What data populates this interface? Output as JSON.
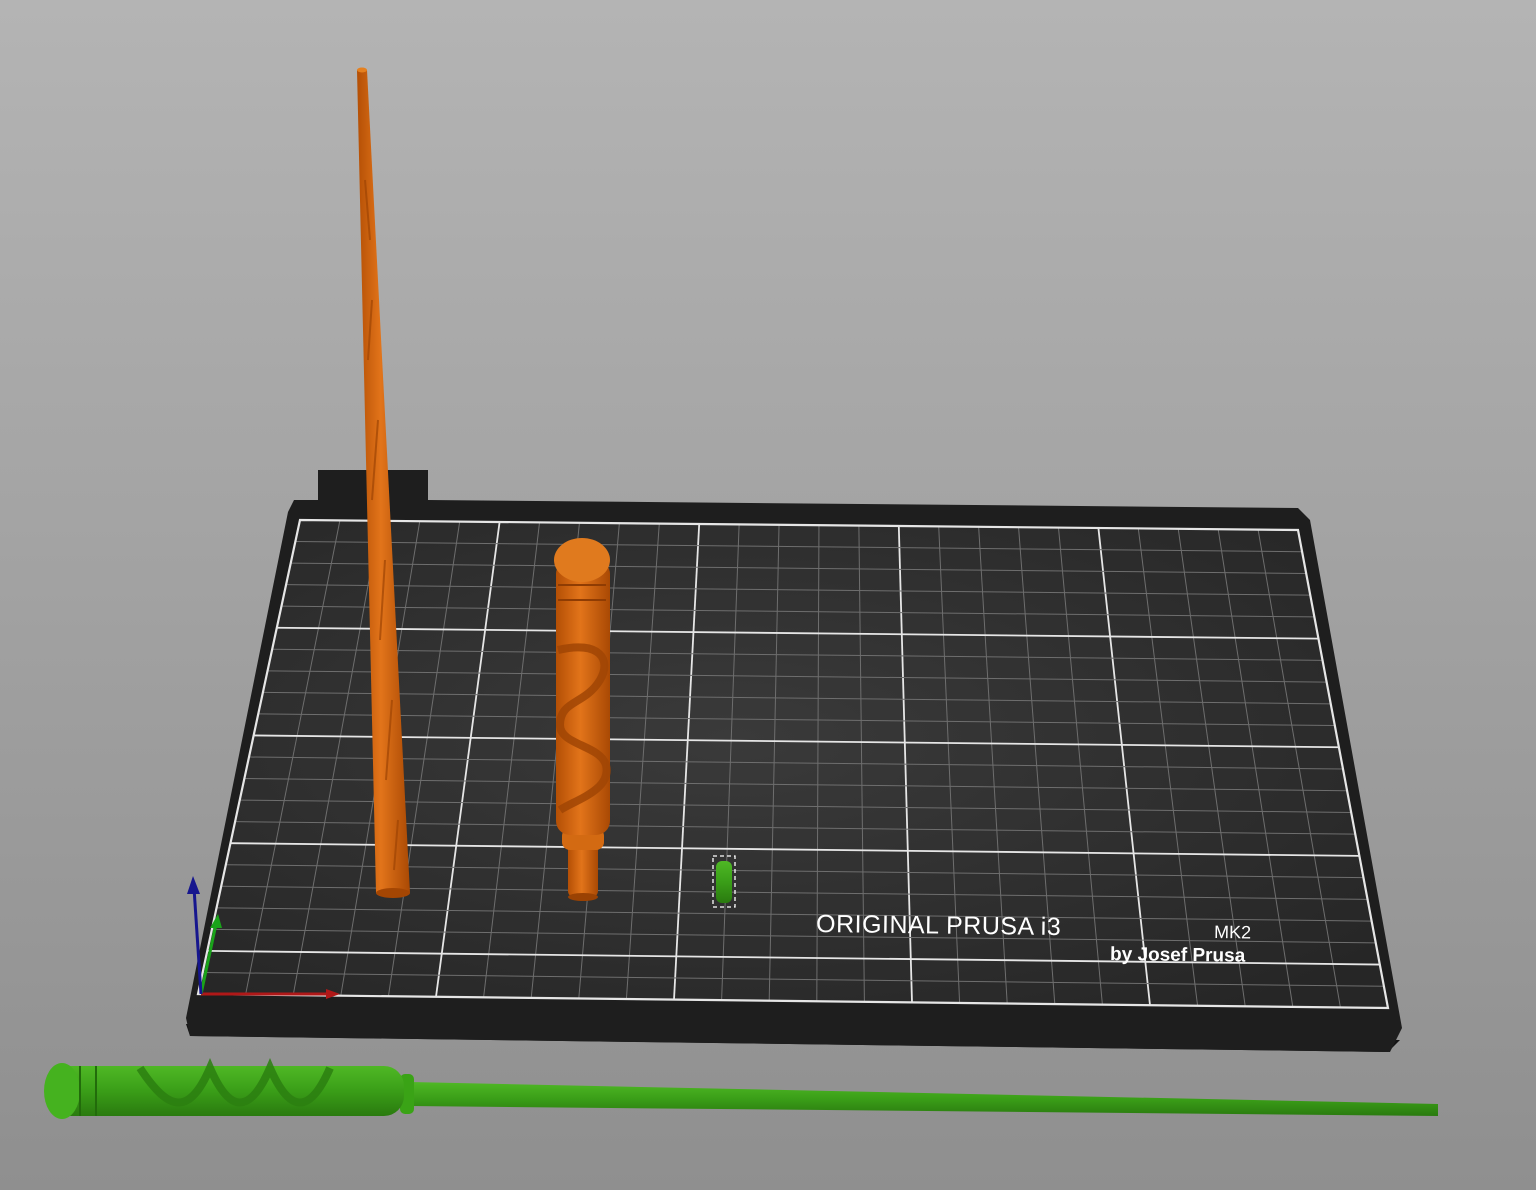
{
  "bed": {
    "brand_line1": "ORIGINAL PRUSA i3",
    "brand_model": "MK2",
    "brand_line2": "by Josef Prusa"
  },
  "colors": {
    "background_top": "#b4b4b4",
    "background_bottom": "#8f8f8f",
    "bed_surface": "#2f2f2f",
    "bed_edge": "#1e1e1e",
    "grid_fine": "#6e6e6e",
    "grid_major": "#e6e6e6",
    "object_unselected": "#d9650b",
    "object_selected": "#3aa316",
    "axis_x": "#b01818",
    "axis_y": "#1aa31a",
    "axis_z": "#16168e"
  },
  "objects": [
    {
      "id": "wand-shaft",
      "state": "unselected"
    },
    {
      "id": "wand-handle",
      "state": "unselected"
    },
    {
      "id": "small-part",
      "state": "selected"
    },
    {
      "id": "full-wand",
      "state": "selected"
    }
  ],
  "axes": [
    "x",
    "y",
    "z"
  ]
}
